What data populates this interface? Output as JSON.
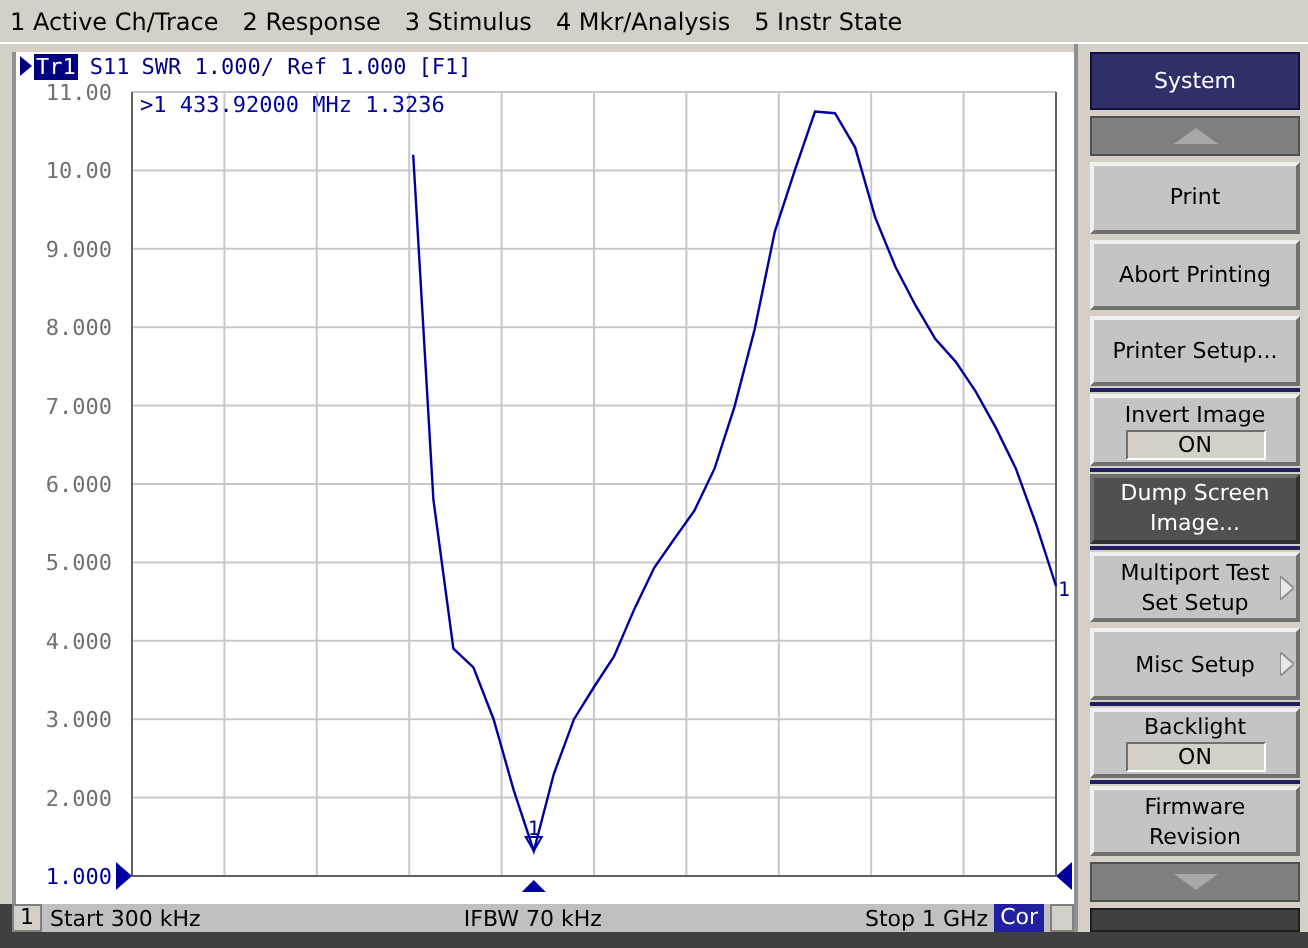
{
  "menu": [
    {
      "label": "1 Active Ch/Trace"
    },
    {
      "label": "2 Response"
    },
    {
      "label": "3 Stimulus"
    },
    {
      "label": "4 Mkr/Analysis"
    },
    {
      "label": "5 Instr State"
    }
  ],
  "trace_header": {
    "trace": "Tr1",
    "selected": true,
    "format": "SWR 1.000/ Ref 1.000",
    "window": "[F1]"
  },
  "chart": {
    "marker_readout": ">1  433.92000 MHz  1.3236",
    "trace_end_label": "1",
    "marker_label": "1",
    "chart_data": {
      "type": "line",
      "categories": [
        null,
        null,
        null,
        null,
        null,
        null,
        null,
        null,
        null,
        null,
        null,
        null,
        null,
        null,
        null,
        null,
        null,
        null,
        null,
        null,
        null,
        null,
        null,
        null,
        null,
        null,
        null,
        null,
        null,
        null,
        null,
        null,
        null,
        null,
        null,
        null,
        null,
        null,
        null,
        null,
        null,
        null,
        null,
        null,
        null,
        null,
        null
      ],
      "series": [
        {
          "name": "S11",
          "color": "#0000a0",
          "values": [
            null,
            null,
            null,
            null,
            null,
            null,
            null,
            null,
            null,
            null,
            null,
            null,
            null,
            null,
            10.2,
            5.8,
            3.9,
            3.66,
            3.0,
            2.1,
            1.32,
            2.3,
            3.0,
            3.41,
            3.8,
            4.4,
            4.93,
            5.3,
            5.66,
            6.2,
            6.99,
            7.97,
            9.22,
            10.0,
            10.75,
            10.73,
            10.29,
            9.4,
            8.77,
            8.28,
            7.85,
            7.56,
            7.18,
            6.72,
            6.2,
            5.49,
            4.7
          ]
        }
      ],
      "ylim": [
        1,
        11
      ],
      "yticks": [
        {
          "value": 11,
          "label": "11.00"
        },
        {
          "value": 10,
          "label": "10.00"
        },
        {
          "value": 9,
          "label": "9.000"
        },
        {
          "value": 8,
          "label": "8.000"
        },
        {
          "value": 7,
          "label": "7.000"
        },
        {
          "value": 6,
          "label": "6.000"
        },
        {
          "value": 5,
          "label": "5.000"
        },
        {
          "value": 4,
          "label": "4.000"
        },
        {
          "value": 3,
          "label": "3.000"
        },
        {
          "value": 2,
          "label": "2.000"
        },
        {
          "value": 1,
          "label": "1.000"
        }
      ],
      "grid": true
    }
  },
  "softkeys": {
    "title": "System",
    "items": [
      {
        "kind": "plain",
        "label": "Print",
        "selected": false
      },
      {
        "kind": "plain",
        "label": "Abort Printing",
        "selected": false
      },
      {
        "kind": "plain",
        "label": "Printer Setup...",
        "selected": false
      },
      {
        "kind": "toggle",
        "label": "Invert Image",
        "value": "ON",
        "selected": false
      },
      {
        "kind": "plain",
        "label": "Dump Screen Image...",
        "selected": true
      },
      {
        "kind": "submenu",
        "label": "Multiport Test Set Setup",
        "selected": false
      },
      {
        "kind": "submenu",
        "label": "Misc Setup",
        "selected": false
      },
      {
        "kind": "toggle",
        "label": "Backlight",
        "value": "ON",
        "selected": false
      },
      {
        "kind": "plain",
        "label": "Firmware Revision",
        "selected": false
      }
    ]
  },
  "status_bar": {
    "channel": "1",
    "start": "Start 300 kHz",
    "ifbw": "IFBW 70 kHz",
    "stop": "Stop 1 GHz",
    "correction": "Cor"
  }
}
